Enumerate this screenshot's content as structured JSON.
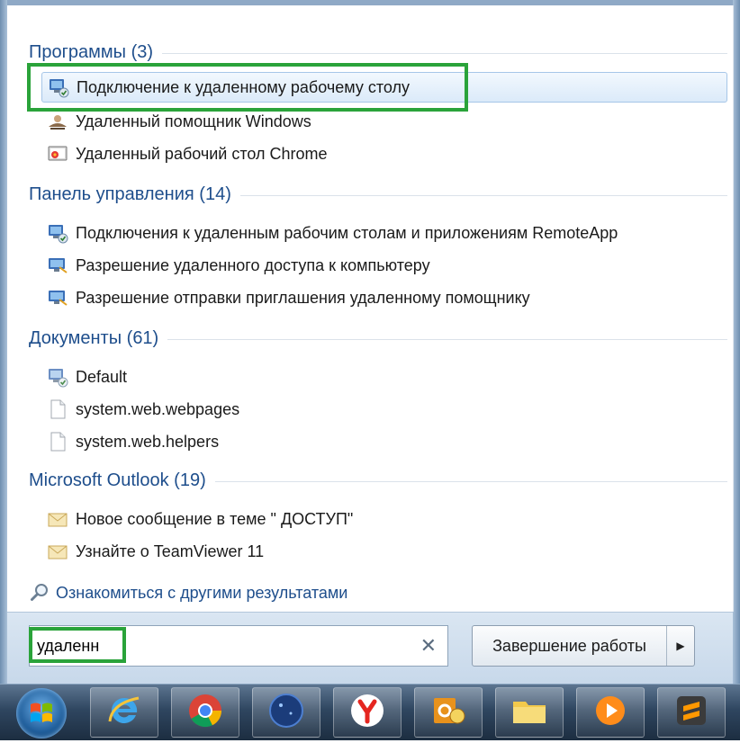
{
  "groups": [
    {
      "title": "Программы (3)",
      "items": [
        {
          "label": "Подключение к удаленному рабочему столу",
          "icon": "remote-desktop-icon",
          "highlighted": true
        },
        {
          "label": "Удаленный помощник Windows",
          "icon": "remote-assistance-icon"
        },
        {
          "label": "Удаленный рабочий стол Chrome",
          "icon": "chrome-remote-desktop-icon"
        }
      ]
    },
    {
      "title": "Панель управления (14)",
      "items": [
        {
          "label": "Подключения к удаленным рабочим столам и приложениям RemoteApp",
          "icon": "remoteapp-icon"
        },
        {
          "label": "Разрешение удаленного доступа к компьютеру",
          "icon": "remote-access-icon"
        },
        {
          "label": "Разрешение отправки приглашения удаленному помощнику",
          "icon": "remote-invite-icon"
        }
      ]
    },
    {
      "title": "Документы (61)",
      "items": [
        {
          "label": "Default",
          "icon": "rdp-file-icon"
        },
        {
          "label": "system.web.webpages",
          "icon": "blank-file-icon"
        },
        {
          "label": "system.web.helpers",
          "icon": "blank-file-icon"
        }
      ]
    },
    {
      "title": "Microsoft Outlook (19)",
      "items": [
        {
          "label": "Новое сообщение в теме \" ДОСТУП\"",
          "icon": "email-icon"
        },
        {
          "label": "Узнайте о TeamViewer 11",
          "icon": "email-icon"
        }
      ]
    }
  ],
  "see_more": {
    "label": "Ознакомиться с другими результатами",
    "icon": "search-icon"
  },
  "search": {
    "value": "удаленн",
    "clear_icon": "close-icon"
  },
  "shutdown": {
    "label": "Завершение работы",
    "arrow_icon": "arrow-right-icon"
  },
  "taskbar": {
    "items": [
      {
        "name": "start-button",
        "icon": "windows-logo-icon"
      },
      {
        "name": "internet-explorer",
        "icon": "internet-explorer-icon"
      },
      {
        "name": "google-chrome",
        "icon": "chrome-icon"
      },
      {
        "name": "globe-app",
        "icon": "globe-icon"
      },
      {
        "name": "yandex-browser",
        "icon": "yandex-icon"
      },
      {
        "name": "outlook",
        "icon": "outlook-icon"
      },
      {
        "name": "file-explorer",
        "icon": "folder-icon"
      },
      {
        "name": "media-player",
        "icon": "media-player-icon"
      },
      {
        "name": "sublime-text",
        "icon": "sublime-text-icon"
      }
    ]
  },
  "colors": {
    "group_title": "#1e4e8c",
    "highlight_box": "#2aa33a",
    "hover_bg": "#dbeaf9"
  }
}
